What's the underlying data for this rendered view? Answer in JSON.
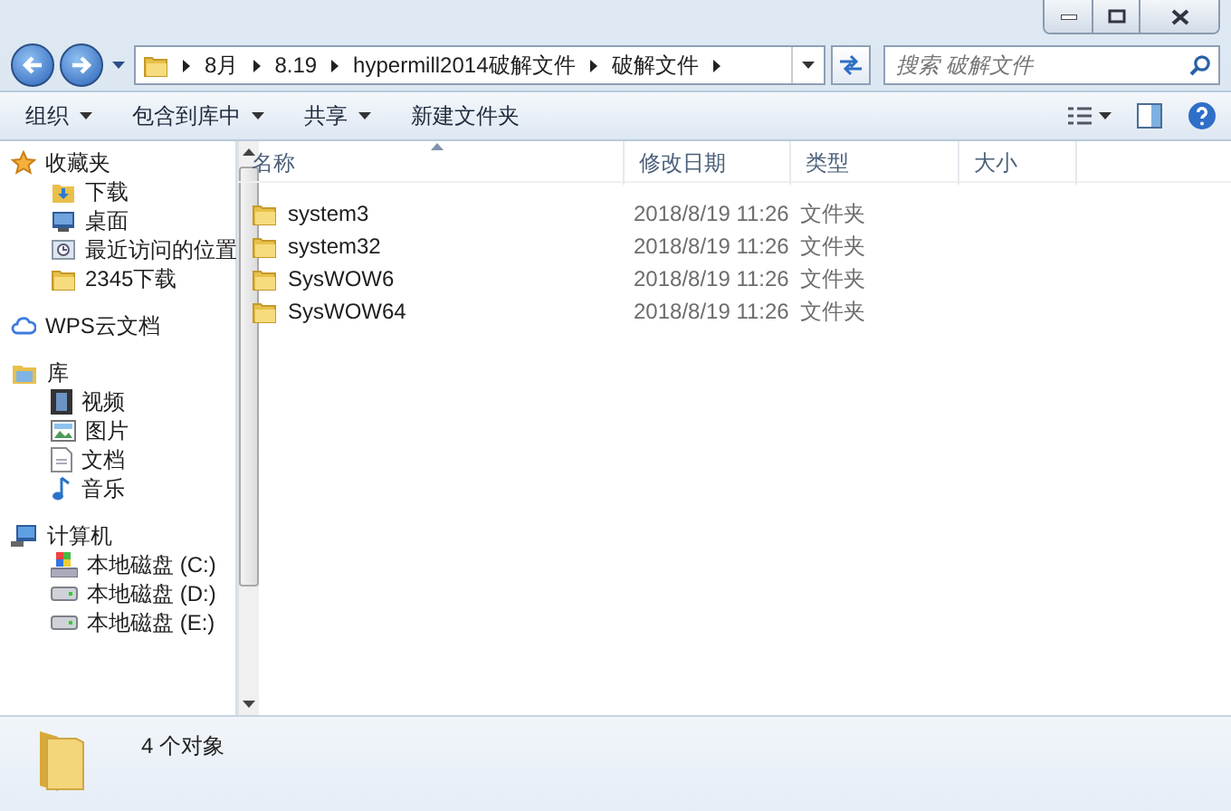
{
  "address": {
    "crumbs": [
      "8月",
      "8.19",
      "hypermill2014破解文件",
      "破解文件"
    ]
  },
  "search": {
    "placeholder": "搜索 破解文件"
  },
  "toolbar": {
    "buttons": [
      {
        "label": "组织",
        "dropdown": true
      },
      {
        "label": "包含到库中",
        "dropdown": true
      },
      {
        "label": "共享",
        "dropdown": true
      },
      {
        "label": "新建文件夹",
        "dropdown": false
      }
    ]
  },
  "sidebar": {
    "groups": [
      {
        "label": "收藏夹",
        "kind": "star",
        "children": [
          {
            "label": "下载",
            "kind": "download"
          },
          {
            "label": "桌面",
            "kind": "desktop"
          },
          {
            "label": "最近访问的位置",
            "kind": "recent"
          },
          {
            "label": "2345下载",
            "kind": "folder"
          }
        ]
      },
      {
        "label": "WPS云文档",
        "kind": "cloud"
      },
      {
        "label": "库",
        "kind": "library",
        "children": [
          {
            "label": "视频",
            "kind": "video"
          },
          {
            "label": "图片",
            "kind": "picture"
          },
          {
            "label": "文档",
            "kind": "document"
          },
          {
            "label": "音乐",
            "kind": "music"
          }
        ]
      },
      {
        "label": "计算机",
        "kind": "computer",
        "children": [
          {
            "label": "本地磁盘 (C:)",
            "kind": "system-drive"
          },
          {
            "label": "本地磁盘 (D:)",
            "kind": "drive"
          },
          {
            "label": "本地磁盘 (E:)",
            "kind": "drive"
          }
        ]
      }
    ]
  },
  "table": {
    "columns": [
      {
        "label": "名称",
        "sorted": true
      },
      {
        "label": "修改日期",
        "sorted": false
      },
      {
        "label": "类型",
        "sorted": false
      },
      {
        "label": "大小",
        "sorted": false
      }
    ],
    "rows": [
      {
        "name": "system3",
        "modified": "2018/8/19 11:26",
        "type": "文件夹"
      },
      {
        "name": "system32",
        "modified": "2018/8/19 11:26",
        "type": "文件夹"
      },
      {
        "name": "SysWOW6",
        "modified": "2018/8/19 11:26",
        "type": "文件夹"
      },
      {
        "name": "SysWOW64",
        "modified": "2018/8/19 11:26",
        "type": "文件夹"
      }
    ]
  },
  "status_bar": {
    "text": "4 个对象"
  }
}
